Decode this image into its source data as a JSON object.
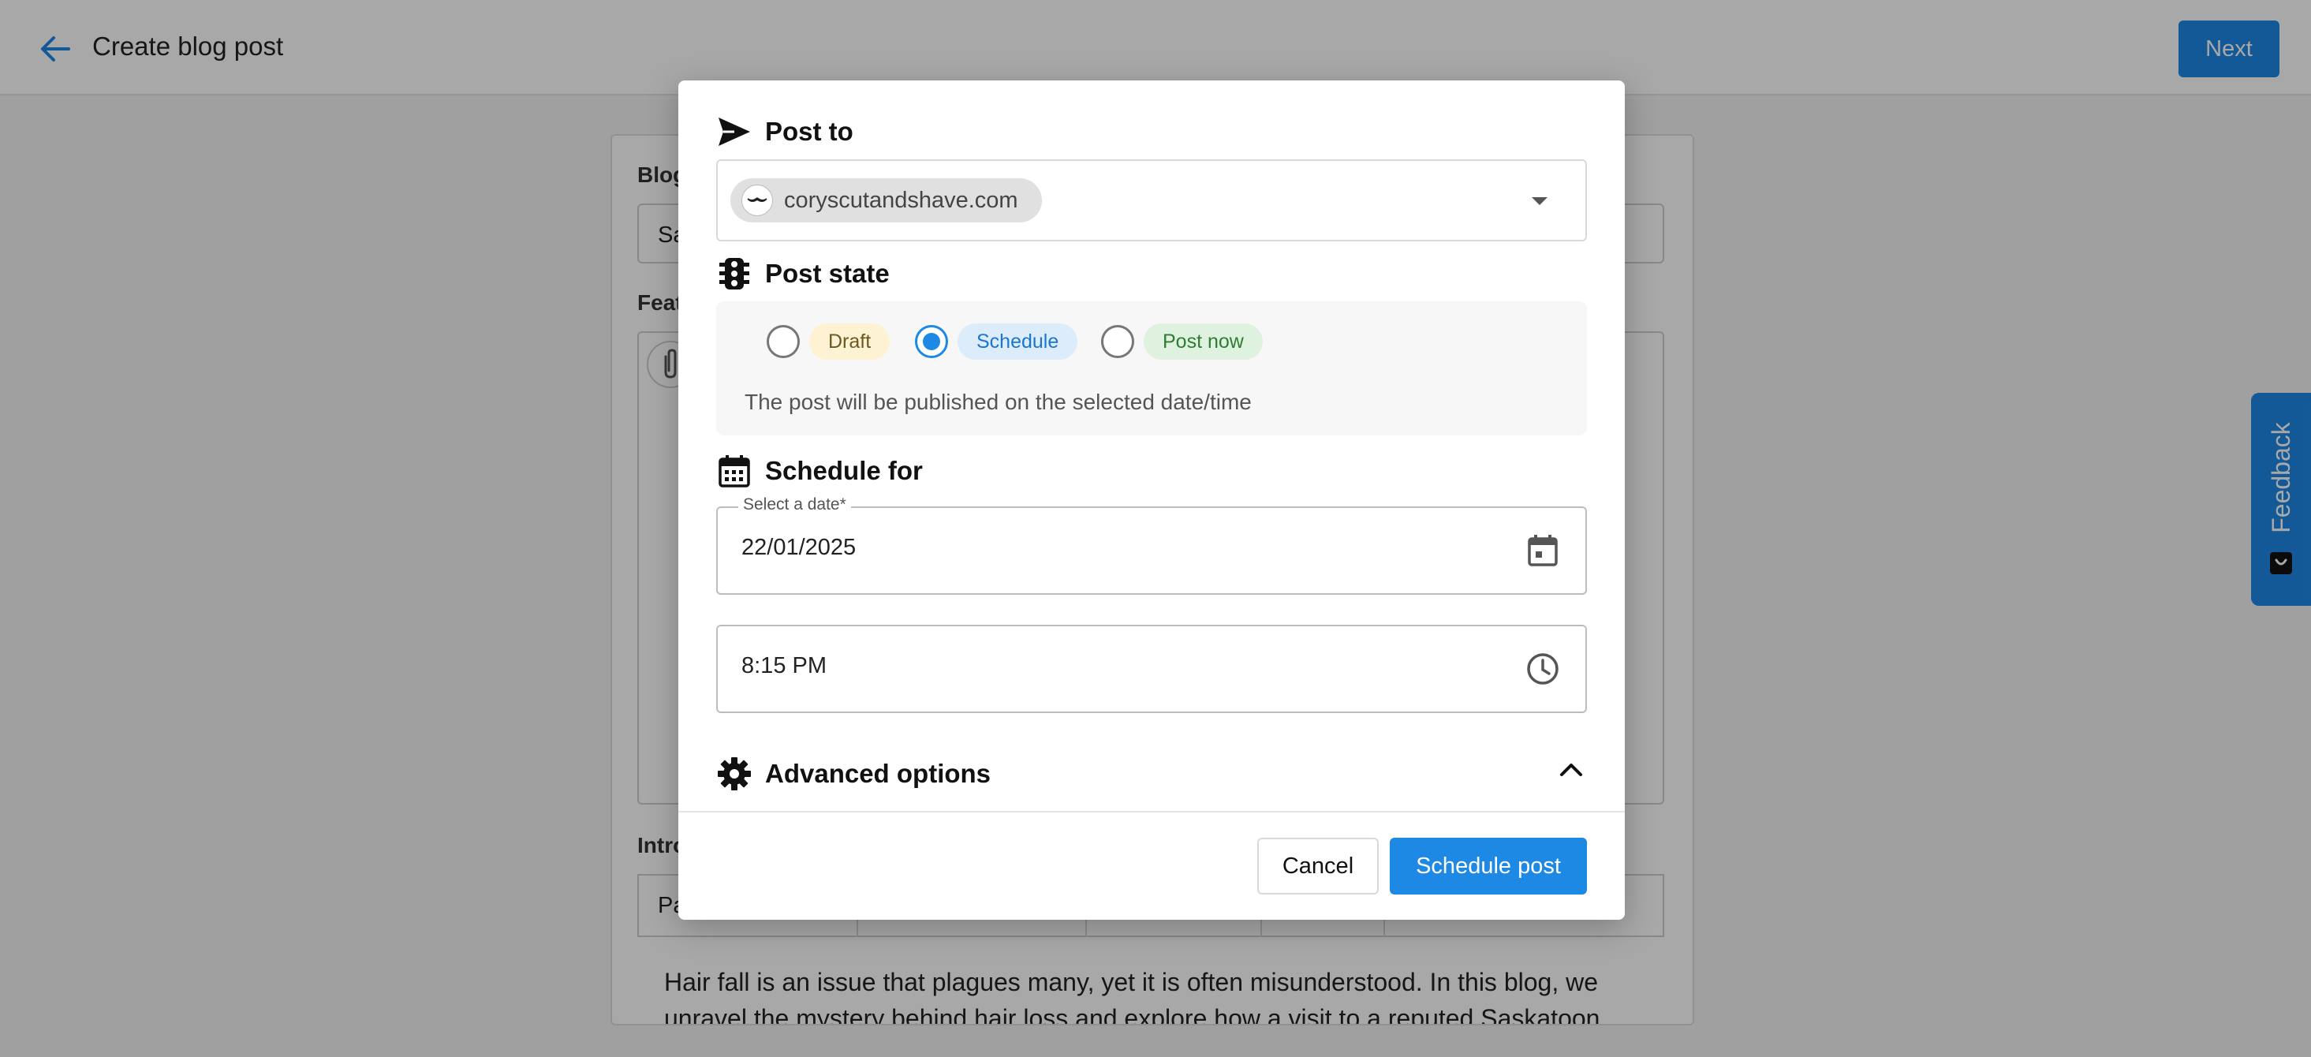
{
  "header": {
    "title": "Create blog post",
    "next_label": "Next"
  },
  "background_form": {
    "blog_label": "Blog",
    "blog_value": "Sa",
    "featured_label": "Feat",
    "intro_label": "Intro",
    "toolbar_first": "Pa",
    "body_line_1": "Hair fall is an issue that plagues many, yet it is often misunderstood. In this blog, we",
    "body_line_2": "unravel the mystery behind hair loss and explore how a visit to a reputed Saskatoon"
  },
  "feedback": {
    "label": "Feedback"
  },
  "modal": {
    "post_to": {
      "title": "Post to",
      "selected_site": "coryscutandshave.com"
    },
    "post_state": {
      "title": "Post state",
      "options": [
        {
          "label": "Draft",
          "checked": false
        },
        {
          "label": "Schedule",
          "checked": true
        },
        {
          "label": "Post now",
          "checked": false
        }
      ],
      "description": "The post will be published on the selected date/time"
    },
    "schedule_for": {
      "title": "Schedule for",
      "date_label": "Select a date*",
      "date_value": "22/01/2025",
      "time_value": "8:15 PM"
    },
    "advanced": {
      "title": "Advanced options"
    },
    "footer": {
      "cancel_label": "Cancel",
      "submit_label": "Schedule post"
    }
  },
  "colors": {
    "accent": "#1e88e5",
    "draft_pill": "#fdf2d2",
    "schedule_pill": "#dcecfb",
    "postnow_pill": "#dff1df"
  }
}
